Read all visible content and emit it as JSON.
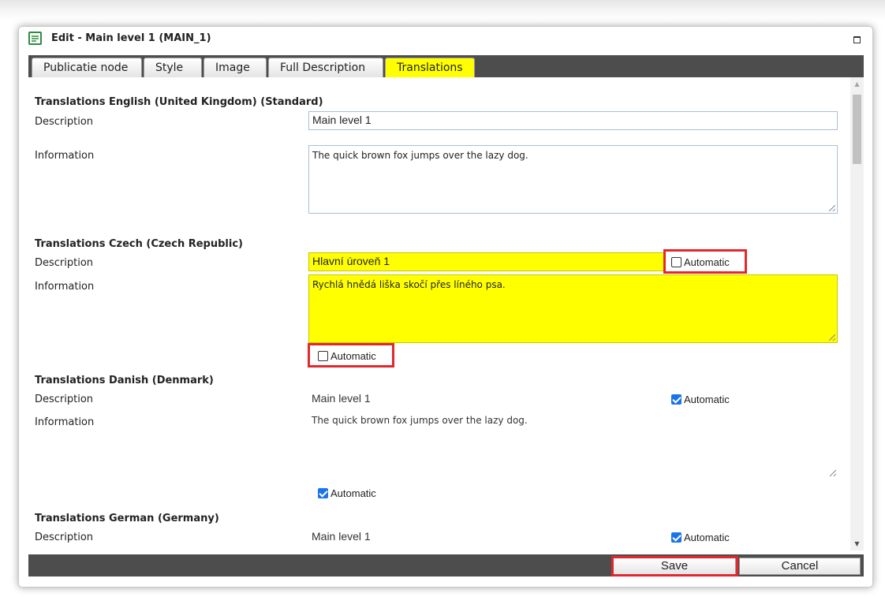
{
  "dialog": {
    "title": "Edit - Main level 1 (MAIN_1)",
    "icons": {
      "title": "form-icon",
      "maximize": "maximize-icon"
    }
  },
  "tabs": [
    {
      "label": "Publicatie node",
      "active": false
    },
    {
      "label": "Style",
      "active": false
    },
    {
      "label": "Image",
      "active": false
    },
    {
      "label": "Full Description",
      "active": false
    },
    {
      "label": "Translations",
      "active": true
    }
  ],
  "labels": {
    "description": "Description",
    "information": "Information",
    "automatic": "Automatic"
  },
  "translations": [
    {
      "title": "Translations English (United Kingdom) (Standard)",
      "description": "Main level 1",
      "information": "The quick brown fox jumps over the lazy dog."
    },
    {
      "title": "Translations Czech (Czech Republic)",
      "description": "Hlavní úroveň 1",
      "information": "Rychlá hnědá liška skočí přes líného psa.",
      "description_automatic": false,
      "information_automatic": false
    },
    {
      "title": "Translations Danish (Denmark)",
      "description": "Main level 1",
      "information": "The quick brown fox jumps over the lazy dog.",
      "description_automatic": true,
      "information_automatic": true
    },
    {
      "title": "Translations German (Germany)",
      "description": "Main level 1",
      "description_automatic": true
    }
  ],
  "footer": {
    "save_label": "Save",
    "cancel_label": "Cancel"
  },
  "colors": {
    "active_tab": "#ffff00",
    "bar": "#4d4d4d",
    "highlight": "#e2282d",
    "checkbox": "#1a73e8"
  }
}
